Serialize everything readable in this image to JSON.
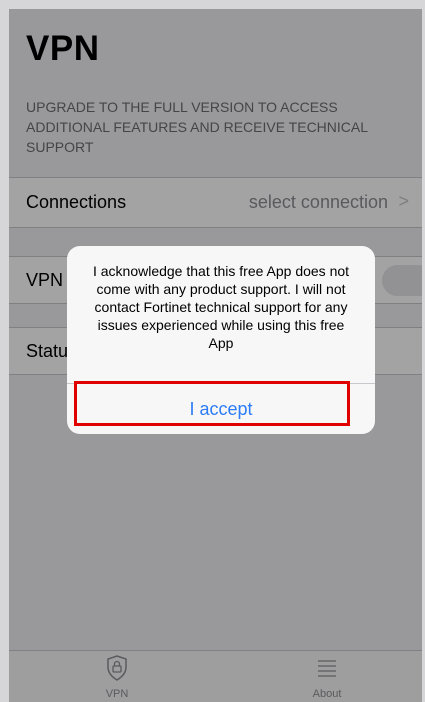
{
  "header": {
    "title": "VPN"
  },
  "upgrade_text": "UPGRADE TO THE FULL VERSION TO ACCESS ADDITIONAL FEATURES AND RECEIVE TECHNICAL SUPPORT",
  "rows": {
    "connections": {
      "label": "Connections",
      "value": "select connection",
      "chevron": ">"
    },
    "vpn": {
      "label": "VPN",
      "toggle_on": false
    },
    "status": {
      "label": "Statu"
    }
  },
  "alert": {
    "message": "I acknowledge that this free App does not come with any product support. I will not contact Fortinet technical support for any issues experienced while using this free App",
    "accept_label": "I accept",
    "accent_color": "#2c7cf6"
  },
  "tabbar": {
    "items": [
      {
        "label": "VPN",
        "icon": "shield-lock-icon"
      },
      {
        "label": "About",
        "icon": "list-icon"
      }
    ]
  },
  "highlight_color": "#e00000"
}
